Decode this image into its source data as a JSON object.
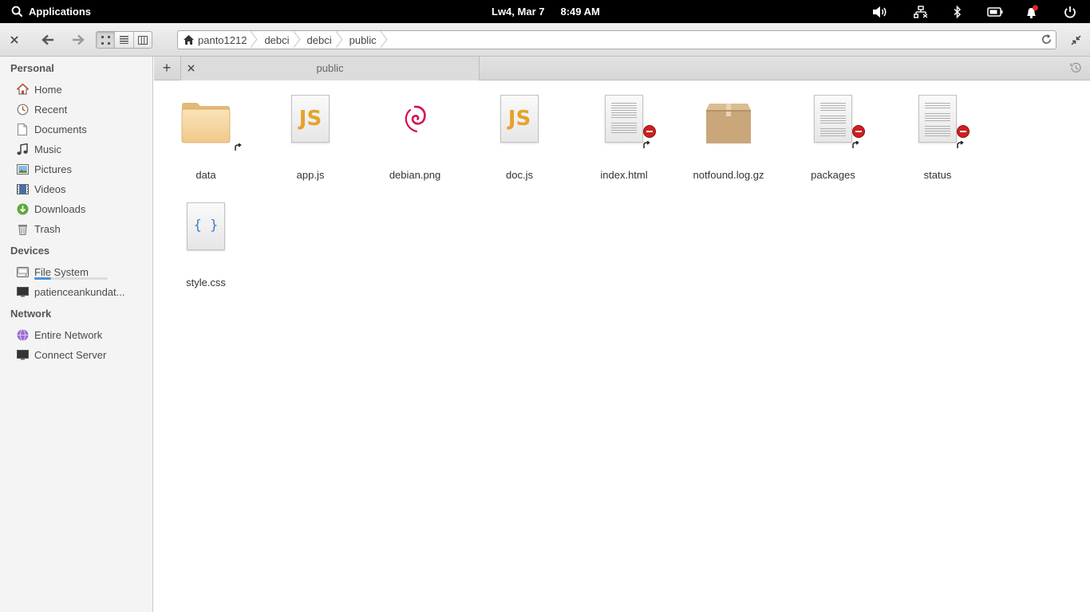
{
  "panel": {
    "apps_label": "Applications",
    "date": "Lw4, Mar 7",
    "time": "8:49 AM"
  },
  "toolbar": {
    "breadcrumbs": [
      "panto1212",
      "debci",
      "debci",
      "public"
    ]
  },
  "sidebar": {
    "personal_header": "Personal",
    "personal": [
      {
        "label": "Home",
        "icon": "home-icon"
      },
      {
        "label": "Recent",
        "icon": "recent-icon"
      },
      {
        "label": "Documents",
        "icon": "documents-icon"
      },
      {
        "label": "Music",
        "icon": "music-icon"
      },
      {
        "label": "Pictures",
        "icon": "pictures-icon"
      },
      {
        "label": "Videos",
        "icon": "videos-icon"
      },
      {
        "label": "Downloads",
        "icon": "downloads-icon"
      },
      {
        "label": "Trash",
        "icon": "trash-icon"
      }
    ],
    "devices_header": "Devices",
    "devices": [
      {
        "label": "File System",
        "icon": "drive-icon",
        "usage": 0.23
      },
      {
        "label": "patienceankundat...",
        "icon": "monitor-icon"
      }
    ],
    "network_header": "Network",
    "network": [
      {
        "label": "Entire Network",
        "icon": "network-icon"
      },
      {
        "label": "Connect Server",
        "icon": "server-icon"
      }
    ]
  },
  "tabs": {
    "active_label": "public"
  },
  "files": [
    {
      "name": "data",
      "type": "folder",
      "symlink": true,
      "unreadable": false
    },
    {
      "name": "app.js",
      "type": "javascript",
      "symlink": false,
      "unreadable": false
    },
    {
      "name": "debian.png",
      "type": "image",
      "symlink": false,
      "unreadable": false
    },
    {
      "name": "doc.js",
      "type": "javascript",
      "symlink": false,
      "unreadable": false
    },
    {
      "name": "index.html",
      "type": "text",
      "symlink": true,
      "unreadable": true
    },
    {
      "name": "notfound.log.gz",
      "type": "archive",
      "symlink": false,
      "unreadable": false
    },
    {
      "name": "packages",
      "type": "text",
      "symlink": true,
      "unreadable": true
    },
    {
      "name": "status",
      "type": "text",
      "symlink": true,
      "unreadable": true
    },
    {
      "name": "style.css",
      "type": "css",
      "symlink": false,
      "unreadable": false
    }
  ],
  "colors": {
    "panel_bg": "#000000",
    "accent": "#4a90d9",
    "js_yellow": "#e4a32b",
    "debian_red": "#d70a53",
    "emblem_red": "#cc2020"
  }
}
